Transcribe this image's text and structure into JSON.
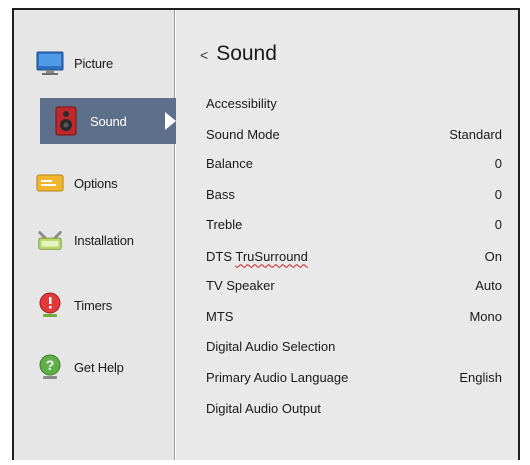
{
  "sidebar": {
    "items": [
      {
        "label": "Picture"
      },
      {
        "label": "Sound"
      },
      {
        "label": "Options"
      },
      {
        "label": "Installation"
      },
      {
        "label": "Timers"
      },
      {
        "label": "Get Help"
      }
    ]
  },
  "main": {
    "back_glyph": "<",
    "title": "Sound",
    "rows": [
      {
        "label": "Accessibility",
        "value": ""
      },
      {
        "label": "Sound Mode",
        "value": "Standard"
      },
      {
        "label": "Balance",
        "value": "0"
      },
      {
        "label": "Bass",
        "value": "0"
      },
      {
        "label": "Treble",
        "value": "0"
      },
      {
        "label": "DTS",
        "label_marked": "TruSurround",
        "value": "On"
      },
      {
        "label": "TV Speaker",
        "value": "Auto"
      },
      {
        "label": "MTS",
        "value": "Mono"
      },
      {
        "label": "Digital Audio Selection",
        "value": ""
      },
      {
        "label": "Primary Audio Language",
        "value": "English"
      },
      {
        "label": "Digital Audio Output",
        "value": ""
      }
    ]
  },
  "colors": {
    "sidebar_bg": "#e6e6e6",
    "main_bg": "#e9e9e9",
    "active_item_bg": "#5d6f8a",
    "spellcheck_underline": "#d11c1c"
  }
}
